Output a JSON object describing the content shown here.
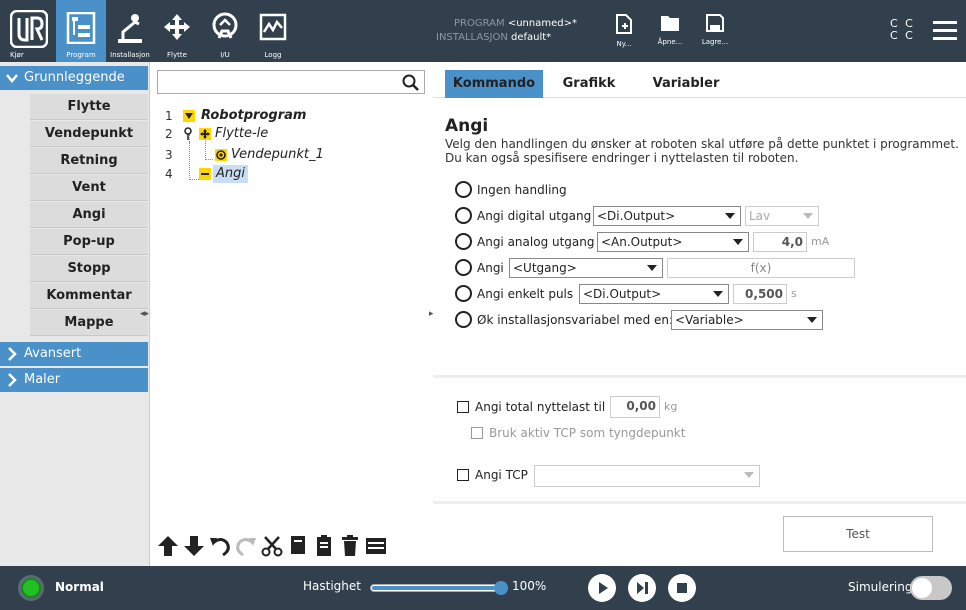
{
  "topbar": {
    "tabs": [
      {
        "label": "Kjør",
        "icon": "ur-logo-icon"
      },
      {
        "label": "Program",
        "icon": "program-tree-icon"
      },
      {
        "label": "Installasjon",
        "icon": "robot-arm-icon"
      },
      {
        "label": "Flytte",
        "icon": "move-arrows-icon"
      },
      {
        "label": "I/U",
        "icon": "io-icon"
      },
      {
        "label": "Logg",
        "icon": "log-icon"
      }
    ],
    "program_label": "PROGRAM",
    "program_value": "<unnamed>*",
    "installation_label": "INSTALLASJON",
    "installation_value": "default*",
    "file_buttons": [
      {
        "label": "Ny...",
        "icon": "new-file-icon"
      },
      {
        "label": "Åpne...",
        "icon": "folder-icon"
      },
      {
        "label": "Lagre...",
        "icon": "save-icon"
      }
    ],
    "cc_top": "C C",
    "cc_bottom": "C C"
  },
  "left_panel": {
    "basic_header": "Grunnleggende",
    "nodes": [
      "Flytte",
      "Vendepunkt",
      "Retning",
      "Vent",
      "Angi",
      "Pop-up",
      "Stopp",
      "Kommentar",
      "Mappe"
    ],
    "advanced_header": "Avansert",
    "templates_header": "Maler"
  },
  "tree": {
    "search_placeholder": "",
    "rows": [
      {
        "num": "1",
        "label": "Robotprogram"
      },
      {
        "num": "2",
        "label": "Flytte-le"
      },
      {
        "num": "3",
        "label": "Vendepunkt_1"
      },
      {
        "num": "4",
        "label": "Angi"
      }
    ]
  },
  "right_panel": {
    "tabs": [
      "Kommando",
      "Grafikk",
      "Variabler"
    ],
    "title": "Angi",
    "description": "Velg den handlingen du ønsker at roboten skal utføre på dette punktet i programmet. Du kan også spesifisere endringer i nyttelasten til roboten.",
    "options": {
      "none": "Ingen handling",
      "digital": "Angi digital utgang",
      "digital_select": "<Di.Output>",
      "digital_value": "Lav",
      "analog": "Angi analog utgang",
      "analog_select": "<An.Output>",
      "analog_value": "4,0",
      "analog_unit": "mA",
      "set": "Angi",
      "set_select": "<Utgang>",
      "set_expr": "f(x)",
      "pulse": "Angi enkelt puls",
      "pulse_select": "<Di.Output>",
      "pulse_value": "0,500",
      "pulse_unit": "s",
      "increment": "Øk installasjonsvariabel med en:",
      "increment_select": "<Variable>"
    },
    "payload": {
      "total_label": "Angi total nyttelast til",
      "total_value": "0,00",
      "total_unit": "kg",
      "tcp_cog_label": "Bruk aktiv TCP som tyngdepunkt",
      "tcp_label": "Angi TCP",
      "tcp_select": ""
    },
    "test_button": "Test"
  },
  "footer": {
    "status": "Normal",
    "speed_label": "Hastighet",
    "speed_percent": 100,
    "speed_value": "100%",
    "simulation_label": "Simulering"
  },
  "colors": {
    "topbar": "#31404c",
    "accent": "#4a90c9",
    "status_green": "#22c022",
    "tree_yellow": "#ffd600"
  }
}
